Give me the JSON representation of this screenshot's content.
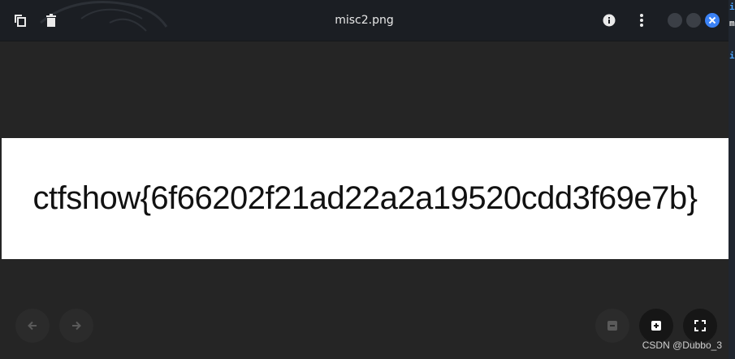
{
  "window": {
    "title": "misc2.png"
  },
  "image_content": {
    "text": "ctfshow{6f66202f21ad22a2a19520cdd3f69e7b}"
  },
  "toolbar": {
    "left_icons": [
      "copy-icon",
      "trash-icon"
    ],
    "right_icons": [
      "info-icon",
      "more-vert-icon"
    ]
  },
  "window_controls": {
    "icons": [
      "minimize-dot",
      "maximize-dot",
      "close-icon"
    ],
    "close_color": "#3b82f6"
  },
  "navigation": {
    "icons": [
      "arrow-left-icon",
      "arrow-right-icon"
    ]
  },
  "zoom_controls": {
    "icons": [
      "zoom-out-icon",
      "zoom-in-icon",
      "fullscreen-icon"
    ]
  },
  "side_strip": {
    "chars": [
      "i",
      "m",
      "i"
    ],
    "colors": [
      "#4aa3ff",
      "#e0e0e0",
      "#4aa3ff"
    ]
  },
  "watermark": {
    "text": "CSDN @Dubbo_3"
  }
}
